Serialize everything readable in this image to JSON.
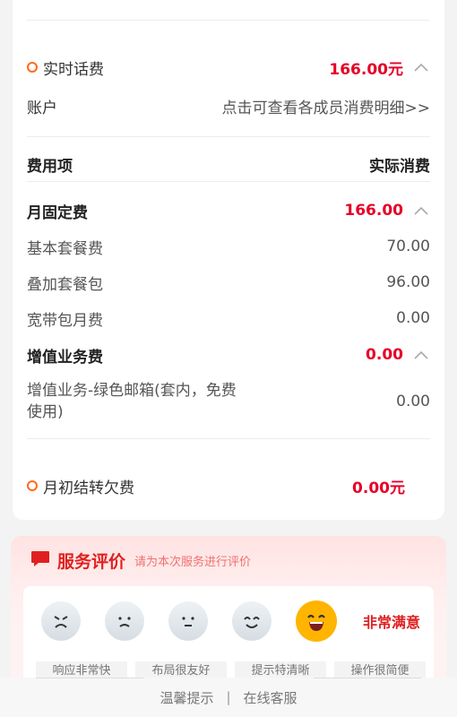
{
  "realtime": {
    "label": "实时话费",
    "amount": "166.00元"
  },
  "account": {
    "label": "账户",
    "link": "点击可查看各成员消费明细>>"
  },
  "header": {
    "item_col": "费用项",
    "actual_col": "实际消费"
  },
  "groups": [
    {
      "name": "月固定费",
      "total": "166.00",
      "items": [
        {
          "name": "基本套餐费",
          "value": "70.00"
        },
        {
          "name": "叠加套餐包",
          "value": "96.00"
        },
        {
          "name": "宽带包月费",
          "value": "0.00"
        }
      ]
    },
    {
      "name": "增值业务费",
      "total": "0.00",
      "items": [
        {
          "name_line1": "增值业务-绿色邮箱(套内，免费",
          "name_line2": "使用)",
          "value": "0.00"
        }
      ]
    }
  ],
  "arrears": {
    "label": "月初结转欠费",
    "amount": "0.00元"
  },
  "rating": {
    "title": "服务评价",
    "subtitle": "请为本次服务进行评价",
    "selected_label": "非常满意",
    "faces": [
      "angry-face-icon",
      "sad-face-icon",
      "neutral-face-icon",
      "smile-face-icon",
      "grin-face-icon"
    ],
    "tags": [
      "响应非常快",
      "布局很友好",
      "提示特清晰",
      "操作很简便"
    ]
  },
  "footer": {
    "tips": "温馨提示",
    "separator": "|",
    "service": "在线客服"
  },
  "colors": {
    "accent_red": "#e60027",
    "dot_orange": "#ff6a1a",
    "face_selected": "#ffb400"
  }
}
